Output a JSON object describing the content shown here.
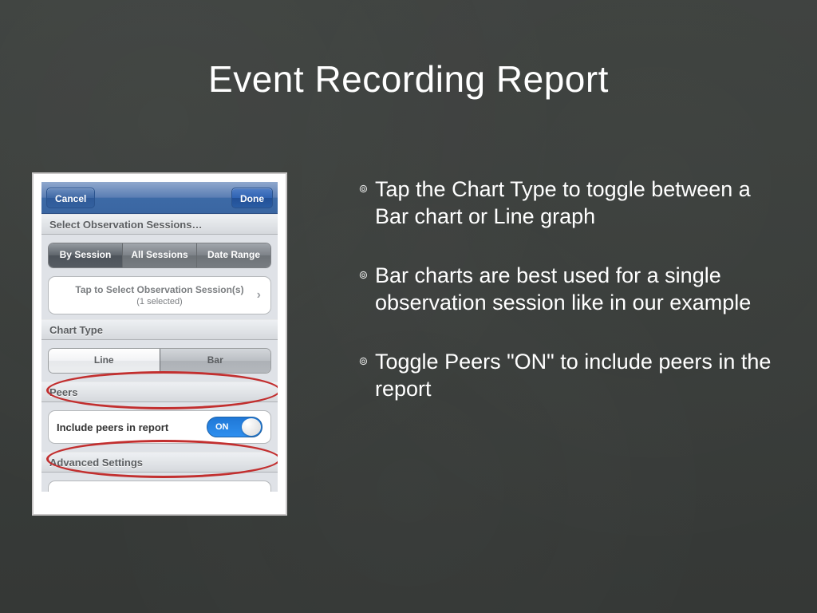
{
  "slide": {
    "title": "Event Recording Report"
  },
  "phone": {
    "toolbar": {
      "cancel": "Cancel",
      "done": "Done"
    },
    "sections": {
      "select_sessions": "Select Observation Sessions…",
      "chart_type": "Chart Type",
      "peers": "Peers",
      "advanced": "Advanced Settings"
    },
    "segments": {
      "by_session": "By Session",
      "all_sessions": "All Sessions",
      "date_range": "Date Range"
    },
    "tap_cell": {
      "line1": "Tap to Select Observation Session(s)",
      "line2": "(1 selected)"
    },
    "chart_segments": {
      "line": "Line",
      "bar": "Bar"
    },
    "peers_row": {
      "label": "Include peers in report",
      "switch_label": "ON"
    }
  },
  "bullets": {
    "b1": "Tap the Chart Type to toggle between a Bar chart or Line graph",
    "b2": "Bar charts are best used for a single  observation session like in our example",
    "b3": "Toggle Peers \"ON\" to include peers in the report"
  }
}
